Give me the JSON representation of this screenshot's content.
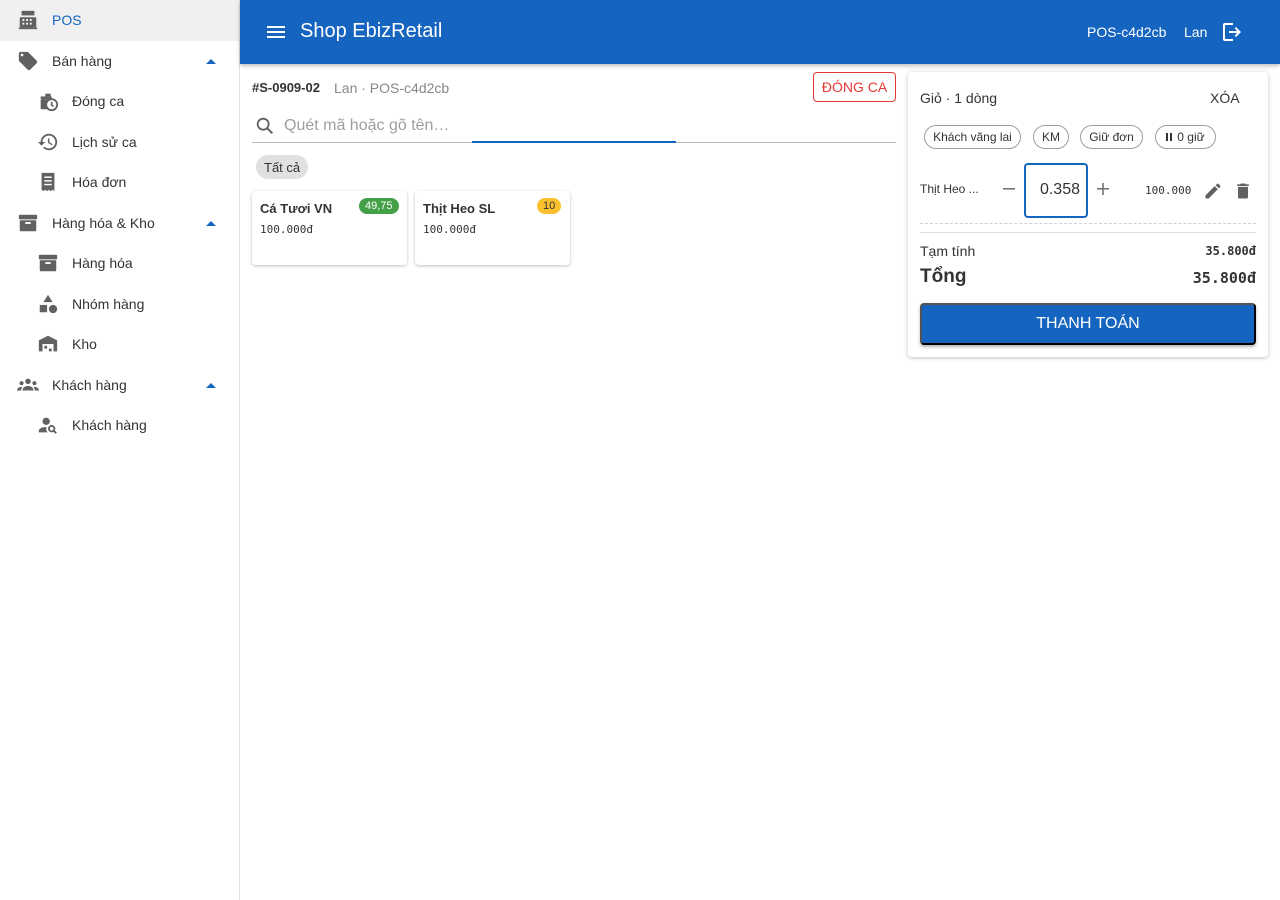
{
  "colors": {
    "primary": "#1565c0",
    "danger": "#e53935",
    "badge_green": "#43a047",
    "badge_yellow": "#fbc02d"
  },
  "sidebar": {
    "items": [
      {
        "label": "POS",
        "icon": "cash-register-icon",
        "active": true
      },
      {
        "label": "Bán hàng",
        "icon": "tag-icon",
        "expanded": true
      },
      {
        "label": "Đóng ca",
        "icon": "clock-shift-icon"
      },
      {
        "label": "Lịch sử ca",
        "icon": "history-icon"
      },
      {
        "label": "Hóa đơn",
        "icon": "receipt-icon"
      },
      {
        "label": "Hàng hóa & Kho",
        "icon": "archive-icon",
        "expanded": true
      },
      {
        "label": "Hàng hóa",
        "icon": "archive-icon"
      },
      {
        "label": "Nhóm hàng",
        "icon": "category-shapes-icon"
      },
      {
        "label": "Kho",
        "icon": "warehouse-icon"
      },
      {
        "label": "Khách hàng",
        "icon": "group-icon",
        "expanded": true
      },
      {
        "label": "Khách hàng",
        "icon": "person-search-icon"
      }
    ]
  },
  "appbar": {
    "title": "Shop EbizRetail",
    "terminal": "POS-c4d2cb",
    "user": "Lan",
    "menu_icon": "menu-icon",
    "logout_icon": "logout-icon"
  },
  "session": {
    "id": "#S-0909-02",
    "meta": "Lan · POS-c4d2cb",
    "close_label": "ĐÓNG CA"
  },
  "search": {
    "placeholder": "Quét mã hoặc gõ tên…",
    "value": ""
  },
  "filters": {
    "all_label": "Tất cả"
  },
  "products": [
    {
      "name": "Cá Tươi VN",
      "price": "100.000đ",
      "stock": "49,75",
      "stock_color": "green"
    },
    {
      "name": "Thịt Heo SL",
      "price": "100.000đ",
      "stock": "10",
      "stock_color": "yellow"
    }
  ],
  "cart": {
    "header": "Giỏ · 1 dòng",
    "clear_label": "XÓA",
    "pills": {
      "customer": "Khách vãng lai",
      "promo": "KM",
      "hold": "Giữ đơn",
      "held": "0 giữ"
    },
    "line": {
      "name": "Thịt Heo ...",
      "qty": "0.358",
      "unit_price": "100.000"
    },
    "subtotal_label": "Tạm tính",
    "subtotal_value": "35.800đ",
    "total_label": "Tổng",
    "total_value": "35.800đ",
    "pay_label": "THANH TOÁN"
  }
}
